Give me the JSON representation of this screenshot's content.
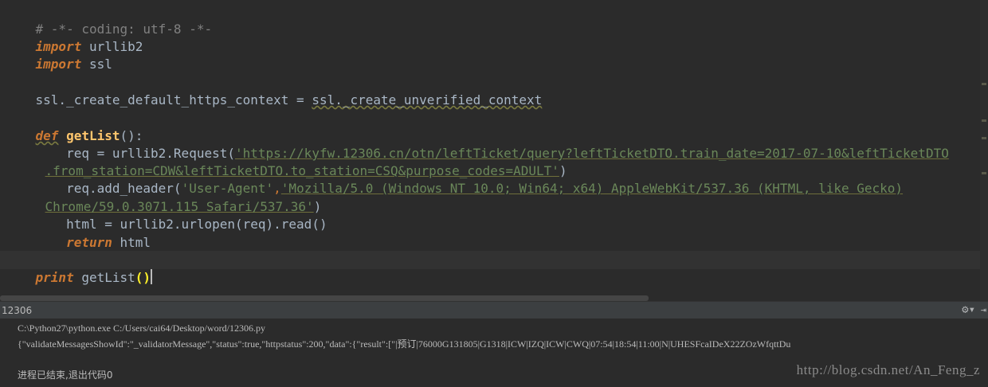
{
  "editor": {
    "lines": {
      "coding": "# -*- coding: utf-8 -*-",
      "import_kw": "import",
      "urllib2": " urllib2",
      "ssl": " ssl",
      "ssl_assign_lhs": "ssl._create_default_https_context = ",
      "ssl_assign_rhs": "ssl._create_unverified_context",
      "def_kw": "def",
      "fn_name": "getList",
      "def_tail": "():",
      "req_prefix": "    req = urllib2.Request(",
      "url_part1": "'https://kyfw.12306.cn/otn/leftTicket/query?leftTicketDTO.train_date=2017-07-10&leftTicketDTO",
      "url_part2": ".from_station=CDW&leftTicketDTO.to_station=CSQ&purpose_codes=ADULT'",
      "close_paren": ")",
      "add_header_prefix": "    req.add_header(",
      "ua_key": "'User-Agent'",
      "comma": ",",
      "ua_value1": "'Mozilla/5.0 (Windows NT 10.0; Win64; x64) AppleWebKit/537.36 (KHTML, like Gecko)",
      "ua_value2": "Chrome/59.0.3071.115 Safari/537.36'",
      "html_line": "    html = urllib2.urlopen(req).read()",
      "return_indent": "    ",
      "return_kw": "return",
      "return_tail": " html",
      "print_kw": "print",
      "print_call": " getList",
      "print_parens": "()"
    }
  },
  "run_panel": {
    "title": "12306",
    "gear_icon": "gear-icon",
    "hide_icon": "hide-icon",
    "command": "C:\\Python27\\python.exe C:/Users/cai64/Desktop/word/12306.py",
    "output": "{\"validateMessagesShowId\":\"_validatorMessage\",\"status\":true,\"httpstatus\":200,\"data\":{\"result\":[\"|预订|76000G131805|G1318|ICW|IZQ|ICW|CWQ|07:54|18:54|11:00|N|UHESFcaIDeX22ZOzWfqttDu",
    "exit_message": "进程已结束,退出代码0"
  },
  "watermark": "http://blog.csdn.net/An_Feng_z",
  "colors": {
    "background": "#2b2b2b",
    "keyword": "#cc7832",
    "string": "#6a8759",
    "function": "#ffc66d",
    "comment": "#808080",
    "text": "#a9b7c6"
  }
}
